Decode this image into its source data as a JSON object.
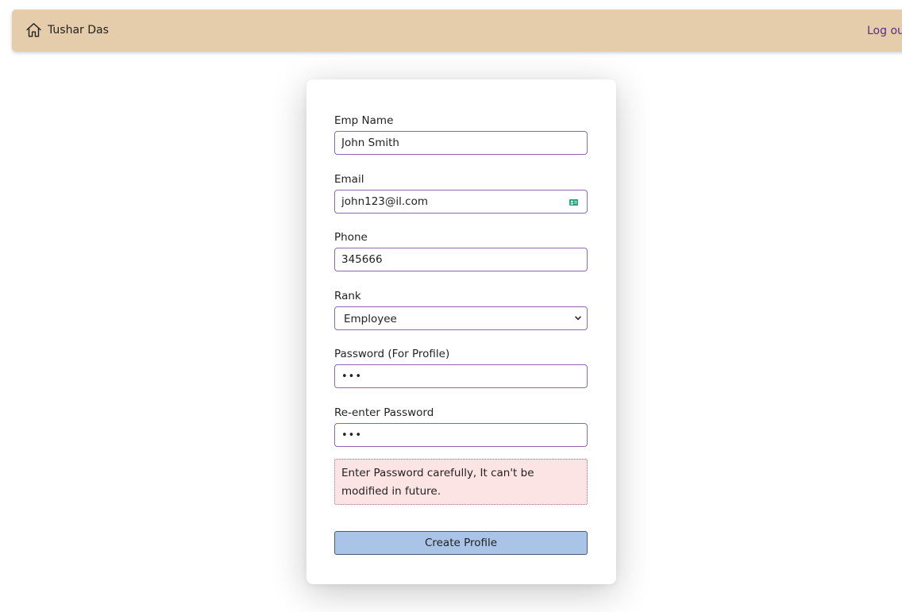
{
  "header": {
    "user_name": "Tushar Das",
    "home_icon": "home-icon",
    "logout_label": "Log out",
    "background_color": "#e5ccaa"
  },
  "form": {
    "emp_name_label": "Emp Name",
    "emp_name_value": "John Smith",
    "email_label": "Email",
    "email_value": "john123@il.com",
    "email_icon": "contact-card-icon",
    "phone_label": "Phone",
    "phone_value": "345666",
    "rank_label": "Rank",
    "rank_selected": "Employee",
    "password_label": "Password (For Profile)",
    "password_value": "abc",
    "reenter_label": "Re-enter Password",
    "reenter_value": "abc",
    "warning_text": "Enter Password carefully, It can't be modified in future.",
    "submit_label": "Create Profile",
    "input_border_color": "#8c6ab3",
    "warning_background": "#fde4e4",
    "button_color": "#a9c4e6"
  }
}
